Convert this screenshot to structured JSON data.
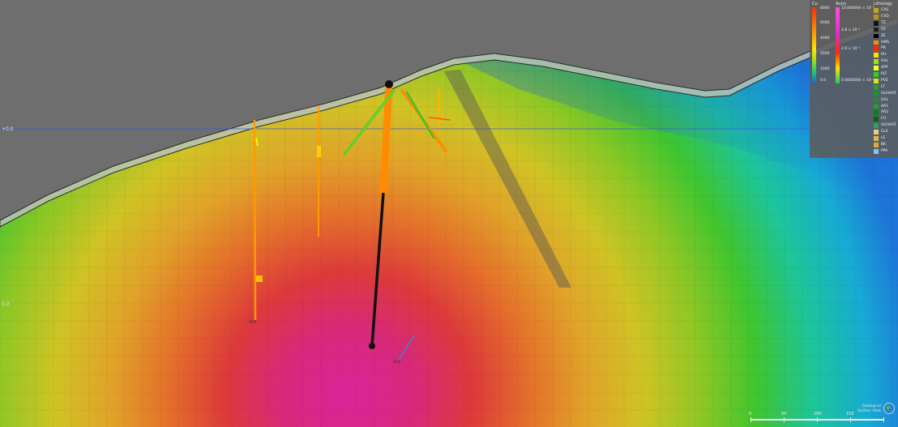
{
  "elevation_labels": {
    "top": "+0.0",
    "middle": "0.0"
  },
  "legend": {
    "cu": {
      "title": "Cu",
      "ticks": [
        "8000",
        "6000",
        "4000",
        "2000",
        "1000",
        "0.0"
      ]
    },
    "au": {
      "title": "Au(s)",
      "ticks": [
        "10.000000 × 10⁻²",
        "4.8 × 10⁻¹",
        "2.9 × 10⁻¹",
        "0.0000000 × 10⁻¹"
      ]
    },
    "lithology": {
      "title": "Lithology",
      "items": [
        {
          "label": "CAS",
          "color": "#c9a227"
        },
        {
          "label": "CVD",
          "color": "#b8951c"
        },
        {
          "label": "TZ",
          "color": "#111111"
        },
        {
          "label": "TZ",
          "color": "#1d1d1d"
        },
        {
          "label": "ZE",
          "color": "#000000"
        },
        {
          "label": "UMS",
          "color": "#ff8c00"
        },
        {
          "label": "PR",
          "color": "#ff2a00"
        },
        {
          "label": "RH",
          "color": "#ffe200"
        },
        {
          "label": "HVL",
          "color": "#9ae21b"
        },
        {
          "label": "APP",
          "color": "#f6ff2b"
        },
        {
          "label": "PLT",
          "color": "#30d21e"
        },
        {
          "label": "PVZ",
          "color": "#d8e31b"
        },
        {
          "label": "LT",
          "color": "#1ea81e"
        },
        {
          "label": "OLIVAAT",
          "color": "#139a2e"
        },
        {
          "label": "GAL",
          "color": "#1f8f24"
        },
        {
          "label": "AR1",
          "color": "#18a82c"
        },
        {
          "label": "AR2",
          "color": "#0d7a1e"
        },
        {
          "label": "FH",
          "color": "#0f5e19"
        },
        {
          "label": "OLIVAAT",
          "color": "#2ba35b"
        },
        {
          "label": "CLS",
          "color": "#e8d07a"
        },
        {
          "label": "LE",
          "color": "#e0b84a"
        },
        {
          "label": "BK",
          "color": "#e8a63a"
        },
        {
          "label": "PPA",
          "color": "#7ec8e8"
        }
      ]
    }
  },
  "drillhole_tags": {
    "hole_a": "0.0",
    "hole_b": "0.0"
  },
  "scale_bar": {
    "labels": [
      "0",
      "50",
      "100",
      "150"
    ]
  },
  "footer": {
    "line1": "Geological",
    "line2": "Section View"
  },
  "colors": {
    "topography": "#b9c2b6",
    "sky": "#6e6e6e",
    "borehole": "#111111",
    "casing": "#ff8c00"
  }
}
